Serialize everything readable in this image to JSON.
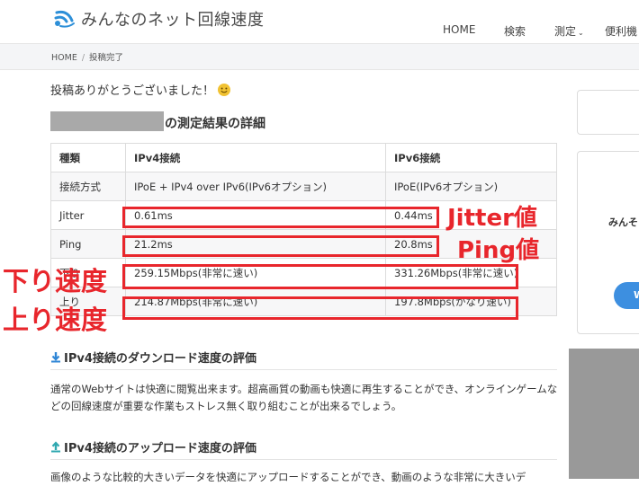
{
  "site": {
    "title": "みんなのネット回線速度"
  },
  "nav": {
    "items": [
      "HOME",
      "検索",
      "測定",
      "便利機"
    ]
  },
  "breadcrumb": {
    "home": "HOME",
    "separator": "/",
    "current": "投稿完了"
  },
  "thanks": {
    "text": "投稿ありがとうございました！"
  },
  "heading": {
    "suffix": "の測定結果の詳細"
  },
  "table": {
    "headers": [
      "種類",
      "IPv4接続",
      "IPv6接続"
    ],
    "rows": [
      [
        "接続方式",
        "IPoE + IPv4 over IPv6(IPv6オプション)",
        "IPoE(IPv6オプション)"
      ],
      [
        "Jitter",
        "0.61ms",
        "0.44ms"
      ],
      [
        "Ping",
        "21.2ms",
        "20.8ms"
      ],
      [
        "下り",
        "259.15Mbps(非常に速い)",
        "331.26Mbps(非常に速い)"
      ],
      [
        "上り",
        "214.87Mbps(非常に速い)",
        "197.8Mbps(かなり速い)"
      ]
    ]
  },
  "annotations": {
    "jitter": "Jitter値",
    "ping": "Ping値",
    "down": "下り速度",
    "up": "上り速度",
    "color": "#e8262c"
  },
  "sections": [
    {
      "icon": "download-icon",
      "title": "IPv4接続のダウンロード速度の評価",
      "body": "通常のWebサイトは快適に閲覧出来ます。超高画質の動画も快適に再生することができ、オンラインゲームなどの回線速度が重要な作業もストレス無く取り組むことが出来るでしょう。"
    },
    {
      "icon": "upload-icon",
      "title": "IPv4接続のアップロード速度の評価",
      "body": "画像のような比較的大きいデータを快適にアップロードすることができ、動画のような非常に大きいデ"
    }
  ],
  "sidebar": {
    "card_text": "みんそ",
    "button_label": "W"
  },
  "colors": {
    "accent_blue": "#3d8fe0",
    "annotation_red": "#e8262c"
  }
}
